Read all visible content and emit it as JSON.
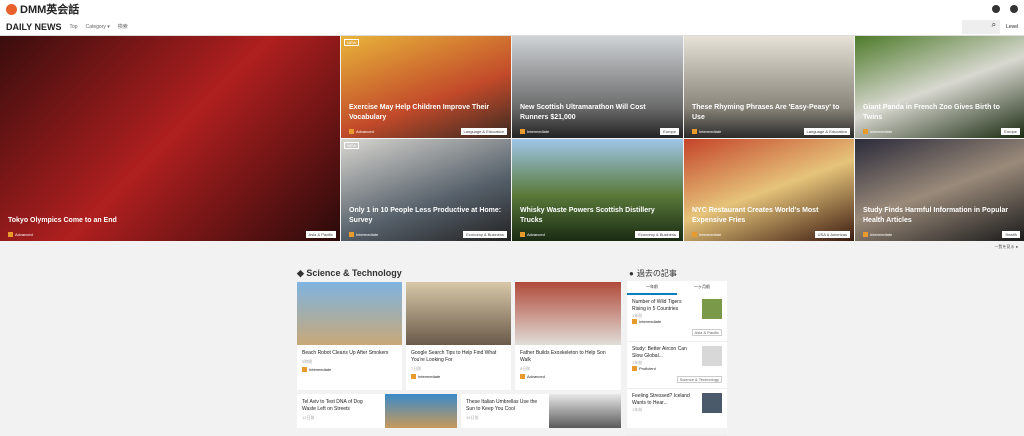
{
  "brand": "DMM英会話",
  "nav": {
    "title": "DAILY NEWS",
    "links": [
      "Top",
      "Category ▾",
      "検索"
    ],
    "level": "Level"
  },
  "hero": [
    {
      "title": "Tokyo Olympics Come to an End",
      "level": "Advanced",
      "tag": "Asia & Pacific"
    },
    {
      "title": "Exercise May Help Children Improve Their Vocabulary",
      "level": "Advanced",
      "tag": "Language & Education",
      "new": "NEW"
    },
    {
      "title": "New Scottish Ultramarathon Will Cost Runners $21,000",
      "level": "Intermediate",
      "tag": "Europe"
    },
    {
      "title": "These Rhyming Phrases Are 'Easy-Peasy' to Use",
      "level": "Intermediate",
      "tag": "Language & Education"
    },
    {
      "title": "Giant Panda in French Zoo Gives Birth to Twins",
      "level": "Intermediate",
      "tag": "Europe"
    },
    {
      "title": "Only 1 in 10 People Less Productive at Home: Survey",
      "level": "Intermediate",
      "tag": "Economy & Business",
      "new": "NEW"
    },
    {
      "title": "Whisky Waste Powers Scottish Distillery Trucks",
      "level": "Advanced",
      "tag": "Economy & Business"
    },
    {
      "title": "NYC Restaurant Creates World's Most Expensive Fries",
      "level": "Intermediate",
      "tag": "USA & Americas"
    },
    {
      "title": "Study Finds Harmful Information in Popular Health Articles",
      "level": "Intermediate",
      "tag": "Health"
    }
  ],
  "more": "一覧を見る ●",
  "section": "Science & Technology",
  "sci": [
    {
      "title": "Beach Robot Cleans Up After Smokers",
      "date": "9時間",
      "level": "Intermediate"
    },
    {
      "title": "Google Search Tips to Help Find What You're Looking For",
      "date": "7日前",
      "level": "Intermediate"
    },
    {
      "title": "Father Builds Exoskeleton to Help Son Walk",
      "date": "8日前",
      "level": "Advanced"
    },
    {
      "title": "Tel Aviv to Test DNA of Dog Waste Left on Streets",
      "date": "12日前"
    },
    {
      "title": "These Italian Umbrellas Use the Sun to Keep You Cool",
      "date": "15日前"
    }
  ],
  "past": {
    "title": "過去の記事",
    "tabs": [
      "一年前",
      "一ヶ月前"
    ],
    "items": [
      {
        "title": "Number of Wild Tigers Rising in 5 Countries",
        "date": "1年前",
        "level": "Intermediate",
        "tag": "Asia & Pacific"
      },
      {
        "title": "Study: Better Aircon Can Slow Global...",
        "date": "1年前",
        "level": "Proficient",
        "tag": "Science & Technology"
      },
      {
        "title": "Feeling Stressed? Iceland Wants to Hear...",
        "date": "1年前"
      }
    ]
  }
}
